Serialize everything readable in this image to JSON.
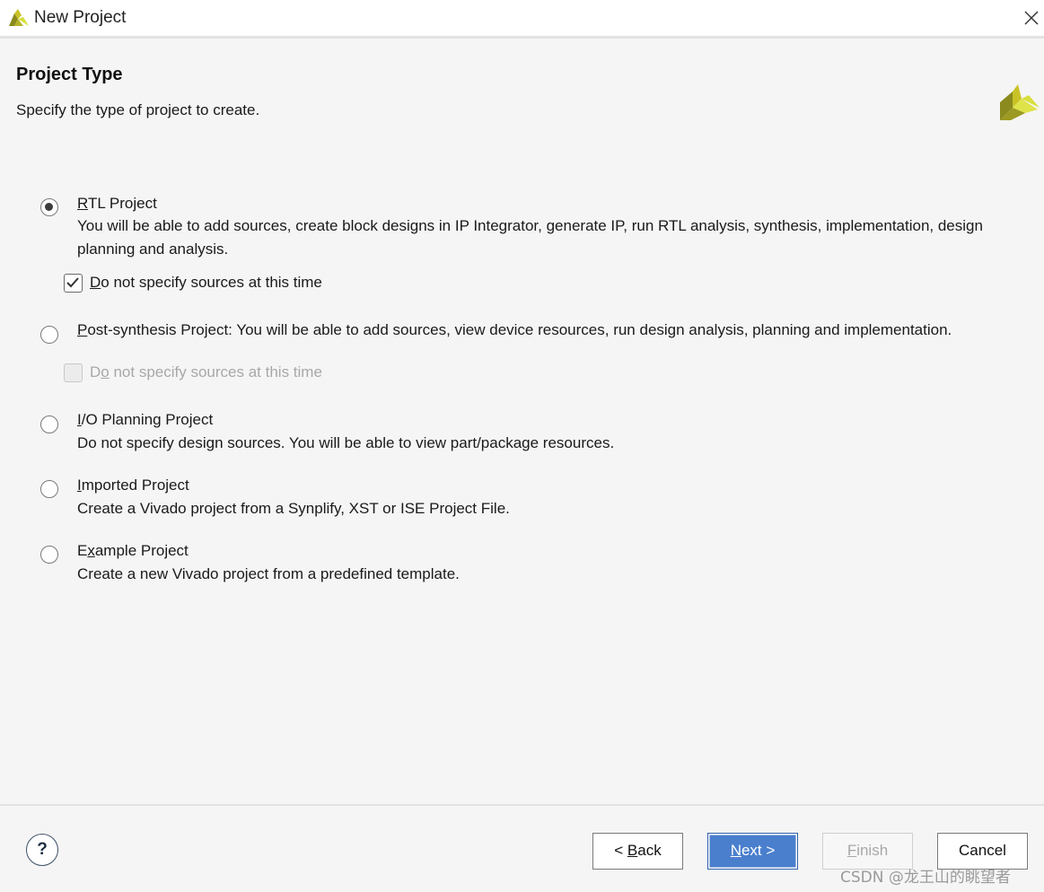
{
  "window": {
    "title": "New Project"
  },
  "header": {
    "title": "Project Type",
    "subtitle": "Specify the type of project to create."
  },
  "options": [
    {
      "mnemonic": "R",
      "label_rest": "TL Project",
      "description": "You will be able to add sources, create block designs in IP Integrator, generate IP, run RTL analysis, synthesis, implementation, design planning and analysis.",
      "selected": true,
      "checkbox": {
        "mnemonic": "D",
        "label_rest": "o not specify sources at this time",
        "checked": true,
        "enabled": true
      }
    },
    {
      "mnemonic": "P",
      "label_rest": "ost-synthesis Project: You will be able to add sources, view device resources, run design analysis, planning and implementation.",
      "selected": false,
      "checkbox": {
        "label_pre": "D",
        "mnemonic": "o",
        "label_rest": " not specify sources at this time",
        "checked": false,
        "enabled": false
      }
    },
    {
      "mnemonic": "I",
      "label_rest": "/O Planning Project",
      "description": "Do not specify design sources. You will be able to view part/package resources.",
      "selected": false
    },
    {
      "mnemonic": "I",
      "label_rest": "mported Project",
      "description": "Create a Vivado project from a Synplify, XST or ISE Project File.",
      "selected": false
    },
    {
      "label_pre": "E",
      "mnemonic": "x",
      "label_rest": "ample Project",
      "description": "Create a new Vivado project from a predefined template.",
      "selected": false
    }
  ],
  "footer": {
    "help_label": "?",
    "back": {
      "pre": "< ",
      "mnemonic": "B",
      "rest": "ack"
    },
    "next": {
      "mnemonic": "N",
      "rest": "ext >"
    },
    "finish": {
      "mnemonic": "F",
      "rest": "inish"
    },
    "cancel": "Cancel"
  },
  "watermark": "CSDN @龙王山的眺望者",
  "colors": {
    "primary_button": "#4a7fce",
    "logo_dark": "#8a8a1e",
    "logo_light": "#d6df3a"
  },
  "icons": {
    "app": "vivado-logo-icon",
    "close": "close-icon",
    "brand": "vivado-logo-icon",
    "check": "checkmark-icon"
  }
}
